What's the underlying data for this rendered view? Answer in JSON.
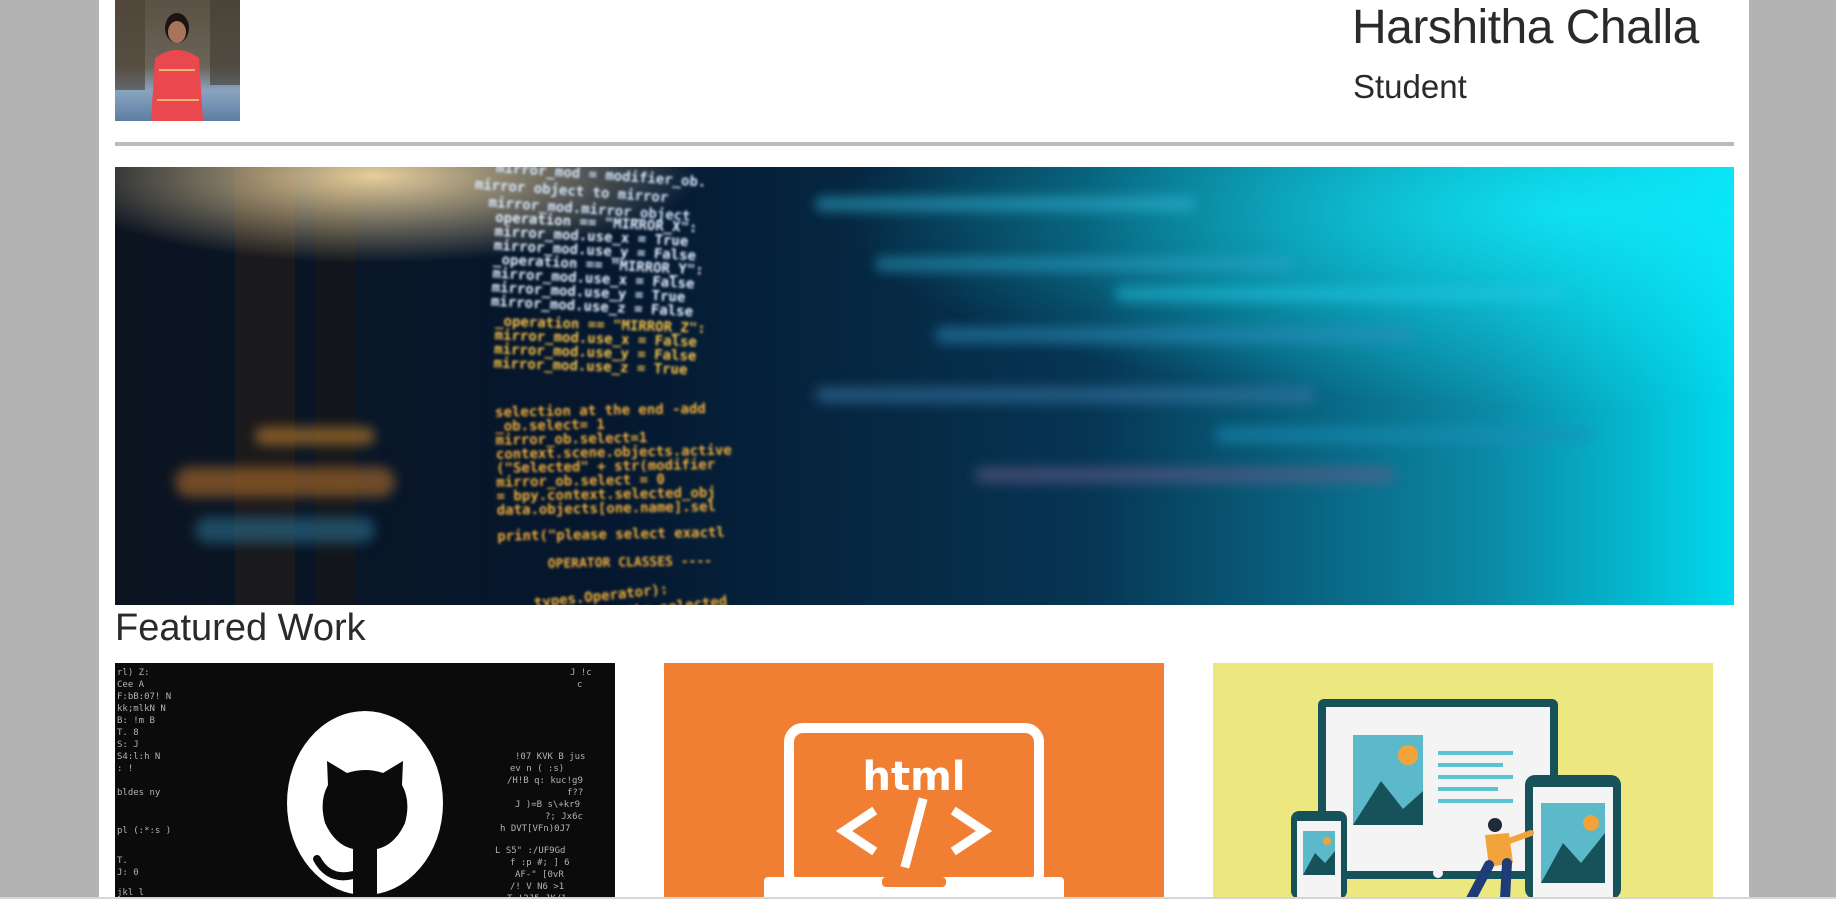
{
  "profile": {
    "name": "Harshitha Challa",
    "role": "Student"
  },
  "featured": {
    "title": "Featured Work",
    "cards": [
      {
        "icon": "github-octocat-icon",
        "bg": "#0b0b0b"
      },
      {
        "icon": "html-laptop-icon",
        "bg": "#f07f34",
        "text": "html"
      },
      {
        "icon": "responsive-devices-icon",
        "bg": "#ece77e"
      }
    ]
  },
  "colors": {
    "page_bg": "#ffffff",
    "outer_bg": "#b3b3b3",
    "rule": "#bbbbbb",
    "text": "#2a2a2a"
  }
}
